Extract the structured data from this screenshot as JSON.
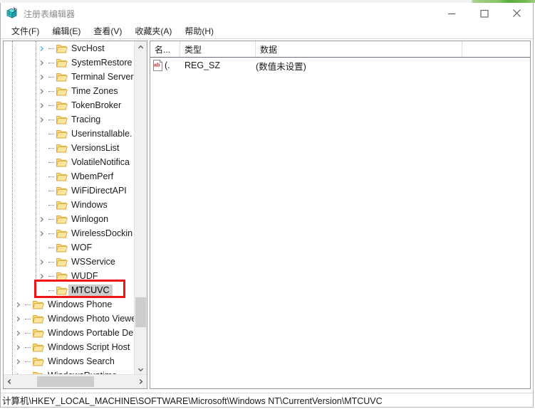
{
  "window": {
    "title": "注册表编辑器",
    "icon": "registry-editor-icon",
    "minimize_label": "最小化",
    "maximize_label": "最大化",
    "close_label": "关闭"
  },
  "menubar": {
    "items": [
      {
        "label": "文件(F)",
        "name": "menu-file"
      },
      {
        "label": "编辑(E)",
        "name": "menu-edit"
      },
      {
        "label": "查看(V)",
        "name": "menu-view"
      },
      {
        "label": "收藏夹(A)",
        "name": "menu-favorites"
      },
      {
        "label": "帮助(H)",
        "name": "menu-help"
      }
    ]
  },
  "tree": {
    "items": [
      {
        "label": "SvcHost",
        "expandable": true,
        "indent": 2,
        "selected": false,
        "chevron_color": "#4fb5e8"
      },
      {
        "label": "SystemRestore",
        "expandable": true,
        "indent": 2,
        "selected": false
      },
      {
        "label": "Terminal Server",
        "expandable": true,
        "indent": 2,
        "selected": false
      },
      {
        "label": "Time Zones",
        "expandable": true,
        "indent": 2,
        "selected": false
      },
      {
        "label": "TokenBroker",
        "expandable": true,
        "indent": 2,
        "selected": false
      },
      {
        "label": "Tracing",
        "expandable": true,
        "indent": 2,
        "selected": false
      },
      {
        "label": "Userinstallable.",
        "expandable": false,
        "indent": 2,
        "selected": false
      },
      {
        "label": "VersionsList",
        "expandable": false,
        "indent": 2,
        "selected": false
      },
      {
        "label": "VolatileNotifica",
        "expandable": false,
        "indent": 2,
        "selected": false
      },
      {
        "label": "WbemPerf",
        "expandable": false,
        "indent": 2,
        "selected": false
      },
      {
        "label": "WiFiDirectAPI",
        "expandable": false,
        "indent": 2,
        "selected": false
      },
      {
        "label": "Windows",
        "expandable": false,
        "indent": 2,
        "selected": false
      },
      {
        "label": "Winlogon",
        "expandable": true,
        "indent": 2,
        "selected": false
      },
      {
        "label": "WirelessDockin",
        "expandable": true,
        "indent": 2,
        "selected": false
      },
      {
        "label": "WOF",
        "expandable": false,
        "indent": 2,
        "selected": false
      },
      {
        "label": "WSService",
        "expandable": true,
        "indent": 2,
        "selected": false
      },
      {
        "label": "WUDF",
        "expandable": true,
        "indent": 2,
        "selected": false
      },
      {
        "label": "MTCUVC",
        "expandable": false,
        "indent": 2,
        "selected": true
      },
      {
        "label": "Windows Phone",
        "expandable": true,
        "indent": 1,
        "selected": false
      },
      {
        "label": "Windows Photo Viewe",
        "expandable": true,
        "indent": 1,
        "selected": false
      },
      {
        "label": "Windows Portable De",
        "expandable": true,
        "indent": 1,
        "selected": false
      },
      {
        "label": "Windows Script Host",
        "expandable": true,
        "indent": 1,
        "selected": false
      },
      {
        "label": "Windows Search",
        "expandable": true,
        "indent": 1,
        "selected": false
      },
      {
        "label": "WindowsRuntime",
        "expandable": true,
        "indent": 1,
        "selected": false
      }
    ]
  },
  "list": {
    "columns": [
      {
        "label": "名...",
        "name": "column-name"
      },
      {
        "label": "类型",
        "name": "column-type"
      },
      {
        "label": "数据",
        "name": "column-data"
      }
    ],
    "rows": [
      {
        "name": "(.",
        "type": "REG_SZ",
        "data": "(数值未设置)",
        "icon": "string-value-icon"
      }
    ]
  },
  "status": {
    "path": "计算机\\HKEY_LOCAL_MACHINE\\SOFTWARE\\Microsoft\\Windows NT\\CurrentVersion\\MTCUVC"
  },
  "annotation": {
    "color": "#f01616",
    "target": "MTCUVC"
  }
}
